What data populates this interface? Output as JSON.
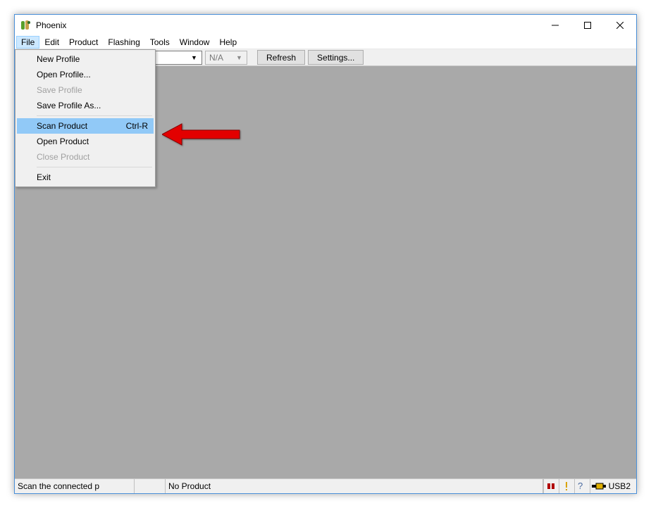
{
  "title": "Phoenix",
  "menubar": [
    "File",
    "Edit",
    "Product",
    "Flashing",
    "Tools",
    "Window",
    "Help"
  ],
  "menubar_open_index": 0,
  "toolbar": {
    "combo1_value": "",
    "combo2_value": "N/A",
    "refresh": "Refresh",
    "settings": "Settings..."
  },
  "file_menu": [
    {
      "label": "New Profile",
      "shortcut": "",
      "enabled": true,
      "highlight": false
    },
    {
      "label": "Open Profile...",
      "shortcut": "",
      "enabled": true,
      "highlight": false
    },
    {
      "label": "Save Profile",
      "shortcut": "",
      "enabled": false,
      "highlight": false
    },
    {
      "label": "Save Profile As...",
      "shortcut": "",
      "enabled": true,
      "highlight": false
    },
    {
      "sep": true
    },
    {
      "label": "Scan Product",
      "shortcut": "Ctrl-R",
      "enabled": true,
      "highlight": true
    },
    {
      "label": "Open Product",
      "shortcut": "",
      "enabled": true,
      "highlight": false
    },
    {
      "label": "Close Product",
      "shortcut": "",
      "enabled": false,
      "highlight": false
    },
    {
      "sep": true
    },
    {
      "label": "Exit",
      "shortcut": "",
      "enabled": true,
      "highlight": false
    }
  ],
  "statusbar": {
    "hint": "Scan the connected p",
    "product": "No Product",
    "usb": "USB2"
  }
}
